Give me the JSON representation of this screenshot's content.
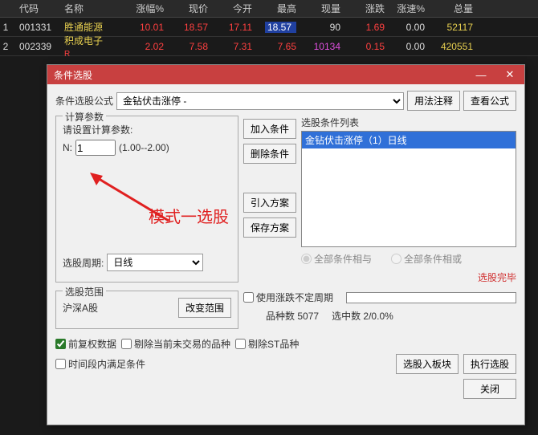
{
  "table": {
    "headers": [
      "代码",
      "名称",
      "涨幅%",
      "现价",
      "今开",
      "最高",
      "现量",
      "涨跌",
      "涨速%",
      "总量"
    ],
    "rows": [
      {
        "idx": "1",
        "code": "001331",
        "name": "胜通能源",
        "pct": "10.01",
        "price": "18.57",
        "open": "17.11",
        "high": "18.57",
        "vol": "90",
        "chg": "1.69",
        "spd": "0.00",
        "tot": "52117",
        "limit": true
      },
      {
        "idx": "2",
        "code": "002339",
        "name": "积成电子",
        "r": "R",
        "pct": "2.02",
        "price": "7.58",
        "open": "7.31",
        "high": "7.65",
        "vol": "10134",
        "chg": "0.15",
        "spd": "0.00",
        "tot": "420551",
        "limit": false
      }
    ]
  },
  "dialog": {
    "title": "条件选股",
    "formula_label": "条件选股公式",
    "formula_value": "金钻伏击涨停 -",
    "btn_usage": "用法注释",
    "btn_view": "查看公式",
    "calc_fs": "计算参数",
    "calc_hint": "请设置计算参数:",
    "param_n": "N:",
    "param_val": "1",
    "param_range": "(1.00--2.00)",
    "period_lbl": "选股周期:",
    "period_val": "日线",
    "btn_add": "加入条件",
    "btn_del": "删除条件",
    "btn_load": "引入方案",
    "btn_save": "保存方案",
    "cond_fs": "选股条件列表",
    "cond_item": "金钻伏击涨停（1）日线",
    "radio_and": "全部条件相与",
    "radio_or": "全部条件相或",
    "done": "选股完毕",
    "range_fs": "选股范围",
    "range_val": "沪深A股",
    "btn_range": "改变范围",
    "chk_period": "使用涨跌不定周期",
    "stat_count_lbl": "品种数",
    "stat_count": "5077",
    "stat_hit_lbl": "选中数",
    "stat_hit": "2/0.0%",
    "chk_fq": "前复权数据",
    "chk_skip": "剔除当前未交易的品种",
    "chk_st": "剔除ST品种",
    "chk_time": "时间段内满足条件",
    "btn_toblock": "选股入板块",
    "btn_run": "执行选股",
    "btn_close": "关闭"
  },
  "annotation": "模式一选股"
}
